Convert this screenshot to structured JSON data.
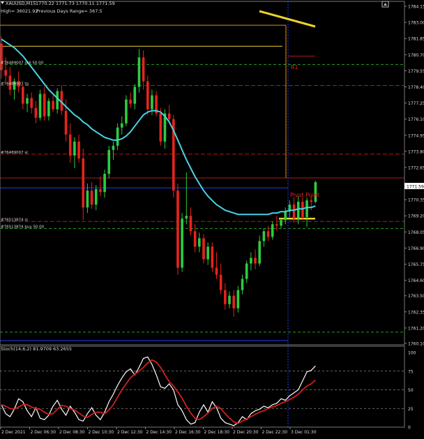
{
  "header": {
    "symbol": "XAUUSD,M15",
    "ohlc": "1770.22 1771.73 1770.11 1771.59",
    "high_line": "High= 36021.92",
    "prev_range": "Previous Days Range= 367.5"
  },
  "price_tag": "1771.59",
  "colors": {
    "background": "#000000",
    "bull": "#2ecc40",
    "bear": "#e8231c",
    "ma": "#47d4e6",
    "stoch_main": "#ffffff",
    "stoch_signal": "#d0201e",
    "yellow": "#f2d22c",
    "orange": "#e88b1e",
    "blue_line": "#1f3cff",
    "green_dash": "#1fa51f",
    "red_dash": "#b01a1a"
  },
  "line_labels": [
    {
      "text": "#76489007 sell 50.00",
      "price": 1780.0
    },
    {
      "text": "#76489007 tp",
      "price": 1778.5
    },
    {
      "text": "#76489007 sl",
      "price": 1773.6
    },
    {
      "text": "#76513874 sl",
      "price": 1768.8
    },
    {
      "text": "#76513874 buy 50.00",
      "price": 1768.3
    }
  ],
  "pivot_label": "Pivot Point",
  "pivot_r1": "R1",
  "chart_data": [
    {
      "type": "candlestick",
      "title": "XAUUSD,M15",
      "ylim": [
        1760.0,
        1784.5
      ],
      "y_ticks": [
        "1784.15",
        "1783.00",
        "1781.85",
        "1780.70",
        "1779.55",
        "1778.40",
        "1777.25",
        "1776.10",
        "1774.95",
        "1773.80",
        "1772.65",
        "1771.59",
        "1770.35",
        "1769.20",
        "1768.05",
        "1766.90",
        "1765.75",
        "1764.60",
        "1763.50",
        "1762.35",
        "1761.20",
        "1760.10"
      ],
      "x_ticks": [
        "2 Dec 2021",
        "2 Dec 06:30",
        "2 Dec 08:30",
        "2 Dec 10:30",
        "2 Dec 12:30",
        "2 Dec 14:30",
        "2 Dec 16:30",
        "2 Dec 18:30",
        "2 Dec 20:30",
        "2 Dec 22:30",
        "3 Dec 01:30"
      ],
      "candles": [
        [
          1781.5,
          1782.0,
          1779.0,
          1779.6
        ],
        [
          1779.6,
          1780.5,
          1778.8,
          1779.2
        ],
        [
          1779.2,
          1779.8,
          1777.8,
          1778.2
        ],
        [
          1778.2,
          1779.0,
          1777.5,
          1778.8
        ],
        [
          1778.8,
          1779.5,
          1778.0,
          1778.4
        ],
        [
          1778.4,
          1778.6,
          1776.8,
          1777.2
        ],
        [
          1777.2,
          1777.9,
          1776.6,
          1777.6
        ],
        [
          1777.6,
          1778.0,
          1776.5,
          1776.9
        ],
        [
          1776.9,
          1777.4,
          1775.8,
          1776.2
        ],
        [
          1776.2,
          1778.2,
          1776.0,
          1777.9
        ],
        [
          1777.9,
          1778.4,
          1776.0,
          1776.3
        ],
        [
          1776.3,
          1777.6,
          1776.0,
          1777.4
        ],
        [
          1777.4,
          1777.8,
          1776.6,
          1776.8
        ],
        [
          1776.8,
          1778.3,
          1776.5,
          1778.1
        ],
        [
          1778.1,
          1778.5,
          1776.4,
          1776.7
        ],
        [
          1776.7,
          1777.5,
          1774.5,
          1775.0
        ],
        [
          1775.0,
          1775.8,
          1773.0,
          1773.5
        ],
        [
          1773.5,
          1774.8,
          1772.6,
          1774.5
        ],
        [
          1774.5,
          1775.0,
          1773.0,
          1773.3
        ],
        [
          1773.3,
          1774.0,
          1768.9,
          1769.8
        ],
        [
          1769.8,
          1771.5,
          1769.4,
          1771.0
        ],
        [
          1771.0,
          1771.6,
          1769.7,
          1770.0
        ],
        [
          1770.0,
          1771.4,
          1769.6,
          1771.1
        ],
        [
          1771.1,
          1772.0,
          1770.6,
          1770.9
        ],
        [
          1770.9,
          1772.5,
          1770.5,
          1772.2
        ],
        [
          1772.2,
          1774.2,
          1771.9,
          1773.9
        ],
        [
          1773.9,
          1774.5,
          1773.2,
          1774.2
        ],
        [
          1774.2,
          1775.8,
          1773.9,
          1775.5
        ],
        [
          1775.5,
          1776.3,
          1775.0,
          1775.8
        ],
        [
          1775.8,
          1777.8,
          1775.6,
          1777.5
        ],
        [
          1777.5,
          1778.0,
          1776.9,
          1777.2
        ],
        [
          1777.2,
          1778.6,
          1776.8,
          1778.4
        ],
        [
          1778.4,
          1781.1,
          1778.0,
          1780.5
        ],
        [
          1780.5,
          1781.0,
          1778.2,
          1778.8
        ],
        [
          1778.8,
          1779.2,
          1776.4,
          1776.8
        ],
        [
          1776.8,
          1778.2,
          1776.4,
          1777.8
        ],
        [
          1777.8,
          1778.1,
          1776.3,
          1776.5
        ],
        [
          1776.5,
          1776.9,
          1774.2,
          1774.5
        ],
        [
          1774.5,
          1776.8,
          1774.0,
          1776.5
        ],
        [
          1776.5,
          1777.1,
          1775.8,
          1776.1
        ],
        [
          1776.1,
          1776.4,
          1770.5,
          1771.0
        ],
        [
          1771.0,
          1771.5,
          1765.0,
          1765.5
        ],
        [
          1765.5,
          1769.4,
          1765.2,
          1769.0
        ],
        [
          1769.0,
          1772.3,
          1768.6,
          1769.2
        ],
        [
          1769.2,
          1769.8,
          1767.8,
          1768.1
        ],
        [
          1768.1,
          1768.6,
          1766.6,
          1767.0
        ],
        [
          1767.0,
          1768.0,
          1766.6,
          1767.6
        ],
        [
          1767.6,
          1767.9,
          1765.8,
          1766.1
        ],
        [
          1766.1,
          1767.3,
          1765.7,
          1767.0
        ],
        [
          1767.0,
          1767.3,
          1765.2,
          1765.5
        ],
        [
          1765.5,
          1766.6,
          1764.7,
          1765.0
        ],
        [
          1765.0,
          1765.8,
          1763.6,
          1763.9
        ],
        [
          1763.9,
          1764.4,
          1762.5,
          1762.9
        ],
        [
          1762.9,
          1763.8,
          1762.6,
          1763.5
        ],
        [
          1763.5,
          1763.9,
          1762.0,
          1762.6
        ],
        [
          1762.6,
          1764.2,
          1762.3,
          1763.9
        ],
        [
          1763.9,
          1765.0,
          1763.6,
          1764.7
        ],
        [
          1764.7,
          1766.0,
          1764.4,
          1765.8
        ],
        [
          1765.8,
          1766.6,
          1765.3,
          1766.2
        ],
        [
          1766.2,
          1766.8,
          1765.4,
          1765.8
        ],
        [
          1765.8,
          1767.8,
          1765.6,
          1767.4
        ],
        [
          1767.4,
          1768.3,
          1767.0,
          1768.1
        ],
        [
          1768.1,
          1768.5,
          1767.4,
          1767.7
        ],
        [
          1767.7,
          1768.8,
          1767.5,
          1768.6
        ],
        [
          1768.6,
          1769.2,
          1768.1,
          1768.5
        ],
        [
          1768.5,
          1769.0,
          1768.3,
          1768.9
        ],
        [
          1768.9,
          1769.8,
          1768.6,
          1769.5
        ],
        [
          1769.5,
          1770.3,
          1769.1,
          1770.0
        ],
        [
          1770.0,
          1770.5,
          1768.7,
          1769.0
        ],
        [
          1769.0,
          1770.6,
          1768.6,
          1770.2
        ],
        [
          1770.2,
          1770.5,
          1768.9,
          1769.1
        ],
        [
          1769.1,
          1770.5,
          1768.4,
          1770.3
        ],
        [
          1770.3,
          1770.6,
          1769.6,
          1770.2
        ],
        [
          1770.2,
          1771.7,
          1770.1,
          1771.6
        ]
      ],
      "ma_values": [
        1781.8,
        1781.6,
        1781.4,
        1781.2,
        1780.9,
        1780.6,
        1780.2,
        1779.8,
        1779.4,
        1779.0,
        1778.6,
        1778.2,
        1777.9,
        1777.6,
        1777.3,
        1777.0,
        1776.7,
        1776.4,
        1776.2,
        1775.9,
        1775.7,
        1775.4,
        1775.2,
        1775.0,
        1774.8,
        1774.7,
        1774.6,
        1774.6,
        1774.7,
        1774.9,
        1775.2,
        1775.6,
        1776.0,
        1776.4,
        1776.6,
        1776.7,
        1776.7,
        1776.6,
        1776.3,
        1775.9,
        1775.3,
        1774.6,
        1773.9,
        1773.2,
        1772.6,
        1772.0,
        1771.5,
        1771.0,
        1770.6,
        1770.3,
        1770.0,
        1769.8,
        1769.6,
        1769.5,
        1769.4,
        1769.3,
        1769.3,
        1769.3,
        1769.3,
        1769.3,
        1769.3,
        1769.3,
        1769.3,
        1769.4,
        1769.4,
        1769.5,
        1769.5,
        1769.6,
        1769.6,
        1769.7,
        1769.7,
        1769.8,
        1769.8,
        1769.9
      ]
    },
    {
      "type": "line",
      "title": "Stoch(14,6,2) 81.9709 63.2655",
      "ylim": [
        0,
        100
      ],
      "y_ticks": [
        "100",
        "75",
        "50",
        "25",
        "0"
      ],
      "series": [
        {
          "name": "81.9709",
          "values": [
            30,
            18,
            14,
            24,
            38,
            34,
            22,
            14,
            26,
            12,
            10,
            16,
            28,
            36,
            24,
            16,
            28,
            20,
            10,
            8,
            18,
            26,
            16,
            10,
            20,
            34,
            44,
            56,
            66,
            74,
            78,
            70,
            80,
            92,
            94,
            84,
            70,
            54,
            52,
            58,
            50,
            30,
            22,
            10,
            4,
            6,
            20,
            30,
            20,
            34,
            26,
            12,
            6,
            4,
            2,
            6,
            14,
            10,
            18,
            22,
            24,
            28,
            26,
            30,
            32,
            38,
            36,
            42,
            46,
            50,
            62,
            74,
            76,
            82
          ]
        },
        {
          "name": "63.2655",
          "values": [
            30,
            28,
            25,
            24,
            27,
            30,
            30,
            27,
            25,
            24,
            20,
            17,
            18,
            24,
            29,
            28,
            25,
            23,
            19,
            15,
            13,
            17,
            20,
            20,
            18,
            23,
            30,
            40,
            50,
            58,
            66,
            71,
            75,
            80,
            86,
            90,
            87,
            80,
            70,
            61,
            55,
            47,
            39,
            28,
            19,
            12,
            10,
            14,
            19,
            25,
            28,
            25,
            18,
            12,
            7,
            5,
            8,
            11,
            14,
            17,
            20,
            22,
            25,
            27,
            29,
            32,
            34,
            37,
            40,
            44,
            50,
            55,
            58,
            63
          ]
        }
      ]
    }
  ]
}
